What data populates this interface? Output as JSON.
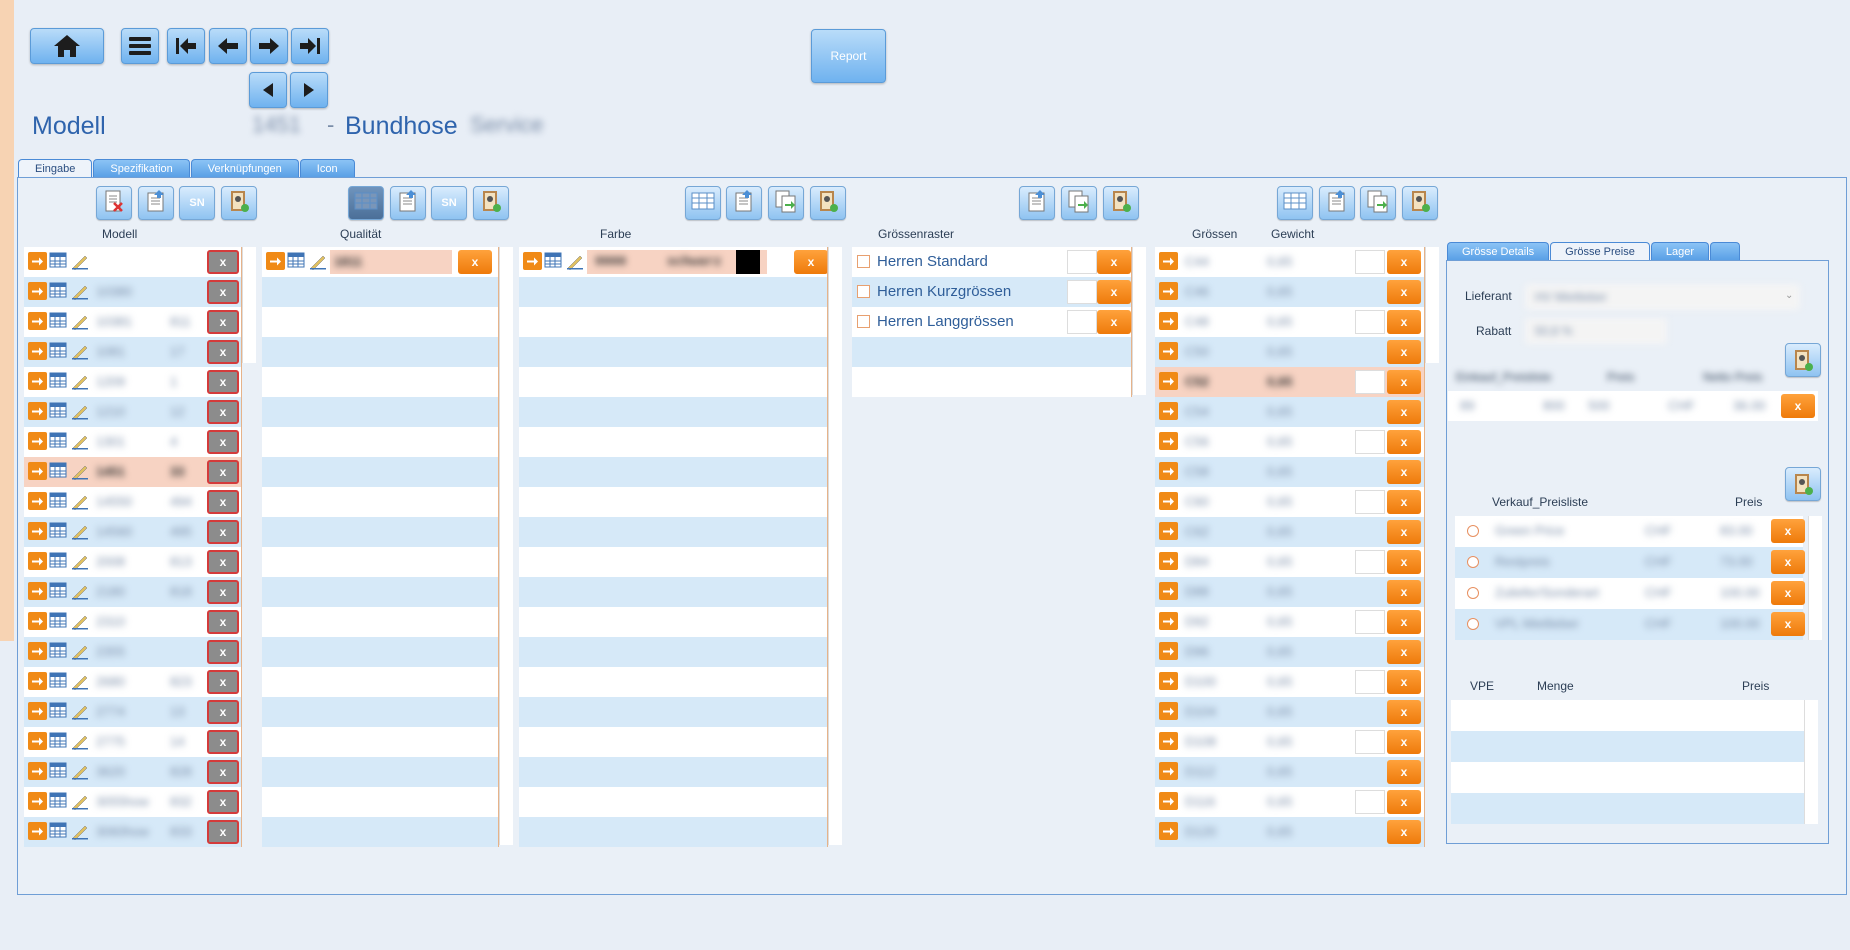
{
  "report_label": "Report",
  "title": {
    "entity": "Modell",
    "number": "1451",
    "dash": "-",
    "name": "Bundhose",
    "suffix": "Service"
  },
  "tabs": [
    "Eingabe",
    "Spezifikation",
    "Verknüpfungen",
    "Icon"
  ],
  "active_tab": "Eingabe",
  "columns": {
    "modell": "Modell",
    "qualitaet": "Qualität",
    "farbe": "Farbe",
    "groessenraster": "Grössenraster",
    "groessen": "Grössen",
    "gewicht": "Gewicht"
  },
  "sn_label": "SN",
  "x_label": "x",
  "modell_rows": [
    {
      "code": "",
      "num": ""
    },
    {
      "code": "10380",
      "num": ""
    },
    {
      "code": "10381",
      "num": "811"
    },
    {
      "code": "1081",
      "num": "17"
    },
    {
      "code": "1209",
      "num": "1"
    },
    {
      "code": "1210",
      "num": "12"
    },
    {
      "code": "1301",
      "num": "4"
    },
    {
      "code": "1451",
      "num": "33"
    },
    {
      "code": "14550",
      "num": "494"
    },
    {
      "code": "14560",
      "num": "495"
    },
    {
      "code": "2008",
      "num": "813"
    },
    {
      "code": "2180",
      "num": "818"
    },
    {
      "code": "2310",
      "num": ""
    },
    {
      "code": "2355",
      "num": ""
    },
    {
      "code": "2680",
      "num": "823"
    },
    {
      "code": "2774",
      "num": "13"
    },
    {
      "code": "2775",
      "num": "14"
    },
    {
      "code": "3620",
      "num": "828"
    },
    {
      "code": "3055how",
      "num": "832"
    },
    {
      "code": "3060how",
      "num": "833"
    }
  ],
  "qualitaet_rows": [
    {
      "code": "1811"
    }
  ],
  "farbe_rows": [
    {
      "code": "9900",
      "name": "schwarz",
      "color": "#000000"
    }
  ],
  "groessenraster_rows": [
    "Herren Standard",
    "Herren Kurzgrössen",
    "Herren Langgrössen"
  ],
  "groessen_rows": [
    {
      "size": "C44",
      "weight": "0,65"
    },
    {
      "size": "C46",
      "weight": "0,65"
    },
    {
      "size": "C48",
      "weight": "0,65"
    },
    {
      "size": "C50",
      "weight": "0,65"
    },
    {
      "size": "C52",
      "weight": "0,65"
    },
    {
      "size": "C54",
      "weight": "0,65"
    },
    {
      "size": "C56",
      "weight": "0,65"
    },
    {
      "size": "C58",
      "weight": "0,65"
    },
    {
      "size": "C60",
      "weight": "0,65"
    },
    {
      "size": "C62",
      "weight": "0,65"
    },
    {
      "size": "D84",
      "weight": "0,65"
    },
    {
      "size": "D88",
      "weight": "0,65"
    },
    {
      "size": "D92",
      "weight": "0,65"
    },
    {
      "size": "D96",
      "weight": "0,65"
    },
    {
      "size": "D100",
      "weight": "0,65"
    },
    {
      "size": "D104",
      "weight": "0,65"
    },
    {
      "size": "D108",
      "weight": "0,65"
    },
    {
      "size": "D112",
      "weight": "0,65"
    },
    {
      "size": "D116",
      "weight": "0,65"
    },
    {
      "size": "D120",
      "weight": "0,65"
    }
  ],
  "side_tabs": [
    "Grösse Details",
    "Grösse Preise",
    "Lager",
    ""
  ],
  "side": {
    "lieferant_label": "Lieferant",
    "lieferant_value": "HV Mietlieber",
    "rabatt_label": "Rabatt",
    "rabatt_value": "50,8 %",
    "einkauf_headers": [
      "Einkauf_Preisliste",
      "Preis",
      "Netto Preis"
    ],
    "einkauf_row": [
      "89",
      "800",
      "500",
      "CHF",
      "36.00"
    ],
    "verkauf_headers": [
      "Verkauf_Preisliste",
      "Preis"
    ],
    "verkauf_rows": [
      {
        "name": "Green Price",
        "cur": "CHF",
        "price": "83.00"
      },
      {
        "name": "Restpreis",
        "cur": "CHF",
        "price": "73.00"
      },
      {
        "name": "Zuliefer/Sonderart",
        "cur": "CHF",
        "price": "100.00"
      },
      {
        "name": "VPL Mietlieber",
        "cur": "CHF",
        "price": "100.00"
      }
    ],
    "vpe_headers": [
      "VPE",
      "Menge",
      "Preis"
    ]
  }
}
